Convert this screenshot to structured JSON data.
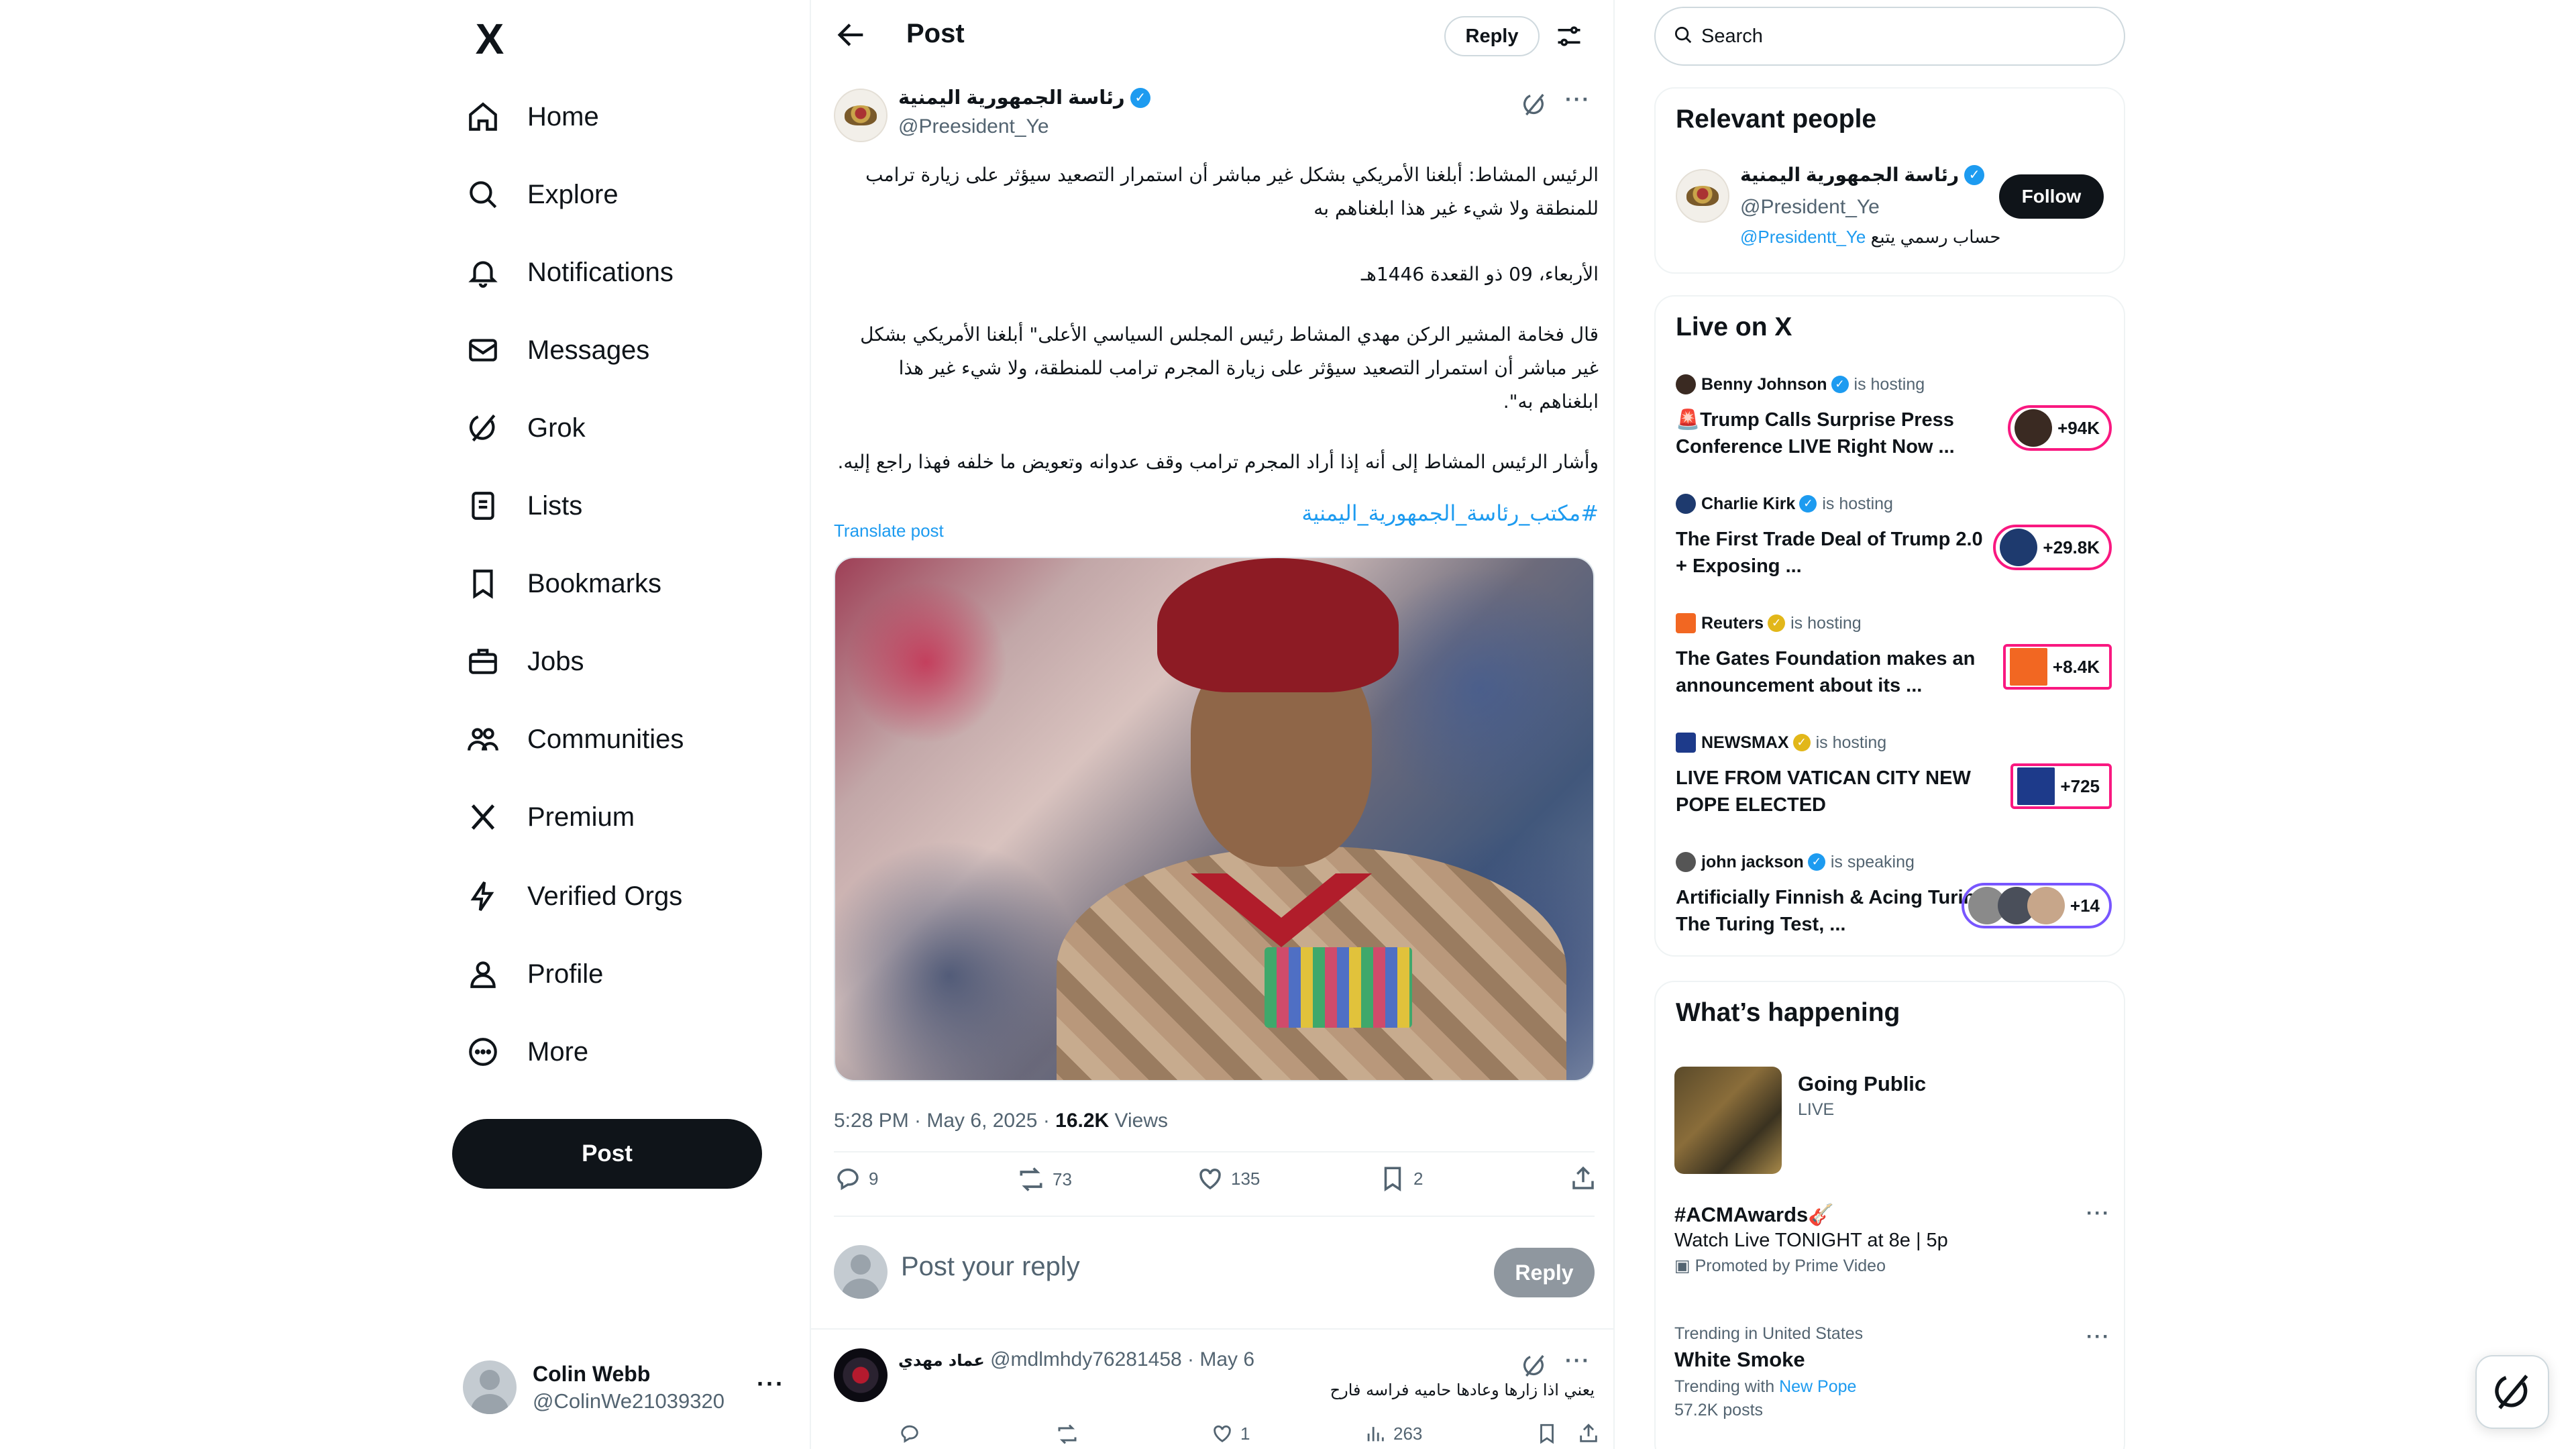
{
  "nav": {
    "logo": "X",
    "items": [
      {
        "label": "Home",
        "icon": "home-icon"
      },
      {
        "label": "Explore",
        "icon": "search-icon"
      },
      {
        "label": "Notifications",
        "icon": "bell-icon"
      },
      {
        "label": "Messages",
        "icon": "envelope-icon"
      },
      {
        "label": "Grok",
        "icon": "grok-icon"
      },
      {
        "label": "Lists",
        "icon": "list-icon"
      },
      {
        "label": "Bookmarks",
        "icon": "bookmark-icon"
      },
      {
        "label": "Jobs",
        "icon": "briefcase-icon"
      },
      {
        "label": "Communities",
        "icon": "people-icon"
      },
      {
        "label": "Premium",
        "icon": "x-logo-icon"
      },
      {
        "label": "Verified Orgs",
        "icon": "lightning-icon"
      },
      {
        "label": "Profile",
        "icon": "person-icon"
      },
      {
        "label": "More",
        "icon": "more-circle-icon"
      }
    ],
    "post_label": "Post",
    "account": {
      "name": "Colin Webb",
      "handle": "@ColinWe21039320",
      "more": "···"
    }
  },
  "header": {
    "title": "Post",
    "reply_label": "Reply"
  },
  "tweet": {
    "author_name": "رئاسة الجمهورية اليمنية",
    "author_handle": "@Preesident_Ye",
    "paragraphs": [
      "الرئيس المشاط: أبلغنا الأمريكي بشكل غير مباشر أن استمرار التصعيد سيؤثر على زيارة ترامب للمنطقة ولا شيء غير هذا ابلغناهم به",
      "الأربعاء، 09 ذو القعدة 1446هـ",
      "قال فخامة المشير الركن مهدي المشاط رئيس المجلس السياسي الأعلى\" أبلغنا الأمريكي بشكل غير مباشر أن استمرار التصعيد سيؤثر على زيارة المجرم ترامب للمنطقة، ولا شيء غير هذا ابلغناهم به\".",
      "وأشار الرئيس المشاط إلى أنه إذا أراد المجرم ترامب وقف عدوانه وتعويض ما خلفه فهذا راجع إليه."
    ],
    "hashtag": "#مكتب_رئاسة_الجمهورية_اليمنية",
    "translate": "Translate post",
    "time": "5:28 PM · May 6, 2025 · ",
    "views_count": "16.2K",
    "views_label": " Views",
    "replies": "9",
    "reposts": "73",
    "likes": "135",
    "bookmarks": "2"
  },
  "reply_box": {
    "placeholder": "Post your reply",
    "button": "Reply"
  },
  "first_reply": {
    "name": "عماد مهدي",
    "handle": "@mdlmhdy76281458",
    "date": " · May 6",
    "text": "يعني اذا زارها وعادها حاميه فراسه فارح",
    "likes": "1",
    "views": "263"
  },
  "right": {
    "search_placeholder": "Search",
    "relevant": {
      "title": "Relevant people",
      "name": "رئاسة الجمهورية اليمنية",
      "handle": "@President_Ye",
      "bio_text": "حساب رسمي يتبع ",
      "bio_link": "@Presidentt_Ye",
      "follow": "Follow"
    },
    "live": {
      "title": "Live on X",
      "items": [
        {
          "host": "Benny Johnson",
          "status": "is hosting",
          "title": "🚨Trump Calls Surprise Press Conference LIVE Right Now ...",
          "count": "+94K",
          "color": "#3a2a22"
        },
        {
          "host": "Charlie Kirk",
          "status": "is hosting",
          "title": "The First Trade Deal of Trump 2.0 + Exposing ...",
          "count": "+29.8K",
          "color": "#1e3a6e"
        },
        {
          "host": "Reuters",
          "status": "is hosting",
          "title": "The Gates Foundation makes an announcement about its ...",
          "count": "+8.4K",
          "color": "#f26722"
        },
        {
          "host": "NEWSMAX",
          "status": "is hosting",
          "title": "LIVE FROM VATICAN CITY NEW POPE ELECTED",
          "count": "+725",
          "color": "#1d3a8a"
        },
        {
          "host": "john jackson",
          "status": "is speaking",
          "title": "Artificially Finnish & Acing Turing The Turing Test, ...",
          "count": "+14",
          "color": "#555555"
        }
      ]
    },
    "happening": {
      "title": "What’s happening",
      "feature_title": "Going Public",
      "feature_live": "LIVE",
      "trends": [
        {
          "small": "",
          "big": "#ACMAwards🎸",
          "sub": "Watch Live TONIGHT at 8e | 5p",
          "sub2": "Promoted by Prime Video"
        },
        {
          "small": "Trending in United States",
          "big": "White Smoke",
          "sub_pre": "Trending with ",
          "sub_link": "New Pope",
          "sub2": "57.2K posts"
        }
      ]
    }
  }
}
